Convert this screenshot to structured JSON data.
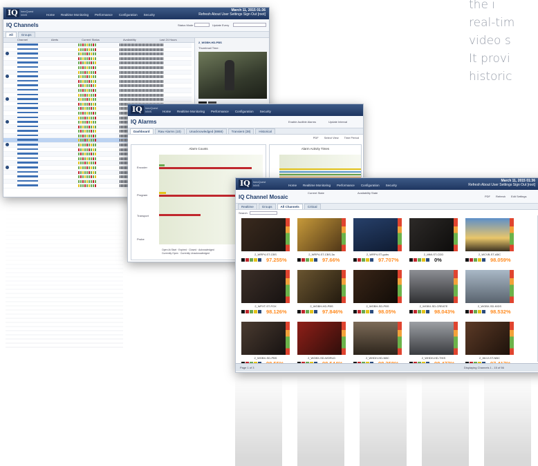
{
  "copy_lines": [
    "the i",
    "real-tim",
    "video s",
    "It provi",
    "historic"
  ],
  "brand": {
    "mark": "IQ",
    "name_line1": "IneoQuest",
    "name_line2": "iVMS"
  },
  "nav": [
    "Home",
    "Realtime Monitoring",
    "Performance",
    "Configuration",
    "Security"
  ],
  "user_menu": [
    "Refresh",
    "About",
    "User Settings",
    "Sign Out [root]"
  ],
  "window_channels": {
    "title": "IQ Channels",
    "timestamp": "March 11, 2015 01:36",
    "status_mode_label": "Status Mode",
    "update_every_label": "Update Every",
    "thumbnail_time_label": "Thumbnail Time:",
    "selected_channel": "2_WGBH-HD-PBS",
    "monitored_label": "Monitored Locations - Current Status",
    "col_channel": "Channel",
    "col_alerts": "Alerts",
    "col_current_status": "Current Status",
    "col_availability": "Availability",
    "col_last_24": "Last 24 Hours",
    "probe_label": "Probe",
    "tab_all": "All",
    "tab_groups": "Groups"
  },
  "window_alarms": {
    "title": "IQ Alarms",
    "tabs": [
      "Dashboard",
      "Raw Alarms (10)",
      "Unacknowledged (8868)",
      "Transient (38)",
      "Historical"
    ],
    "enable_audible": "Enable Audible Alarms",
    "update_interval": "Update Interval",
    "pdf": "PDF",
    "select_view": "Select View",
    "time_period": "Time Period",
    "chart_left_title": "Alarm Counts",
    "chart_right_title": "Alarm Activity Times",
    "categories": [
      "Encoder",
      "Program",
      "Transport",
      "Probe"
    ],
    "legend": [
      "Open At Start",
      "Expired",
      "Closed",
      "Acknowledged",
      "Currently Open",
      "Currently Unacknowledged"
    ]
  },
  "window_mosaic": {
    "title": "IQ Channel Mosaic",
    "current_state": "Current State",
    "availability_state": "Availability State",
    "tabs": [
      "Realtime",
      "Groups",
      "All Channels",
      "Critical"
    ],
    "search_label": "Search",
    "pdf": "PDF",
    "refresh": "Refresh",
    "edit_settings": "Edit Settings",
    "tiles": [
      {
        "name": "2_WRP4-ST-CBS",
        "pct": "97.255%"
      },
      {
        "name": "2_WRP4-ST-CBS-3a",
        "pct": "97.66%"
      },
      {
        "name": "2_WRP4-ST-gubs",
        "pct": "97.707%"
      },
      {
        "name": "2_MMI-ST-CDD",
        "pct": "0%"
      },
      {
        "name": "2_WCVB-ST-ABC",
        "pct": "98.059%"
      },
      {
        "name": "2_WFXT-ST-FOX",
        "pct": "98.126%"
      },
      {
        "name": "2_WGBH-HD-PBS",
        "pct": "97.846%"
      },
      {
        "name": "2_WGBH-SD-PBS",
        "pct": "98.05%"
      },
      {
        "name": "2_WGBX-SD-CREATE",
        "pct": "98.043%"
      },
      {
        "name": "2_WGBX-SD-KIDS",
        "pct": "98.532%"
      },
      {
        "name": "2_WGBX-SD-PBS",
        "pct": "98.55%"
      },
      {
        "name": "2_WGBX-SD-WORLD",
        "pct": "98.544%"
      },
      {
        "name": "2_WHDH-HD-NBC",
        "pct": "98.358%"
      },
      {
        "name": "2_WHDH-HD-THIS",
        "pct": "98.477%"
      },
      {
        "name": "2_WLVI-ST-NBC",
        "pct": "97.417%"
      }
    ],
    "pager": "Page 1 of 3",
    "displaying": "Displaying Channels 1 - 15 of 56"
  }
}
